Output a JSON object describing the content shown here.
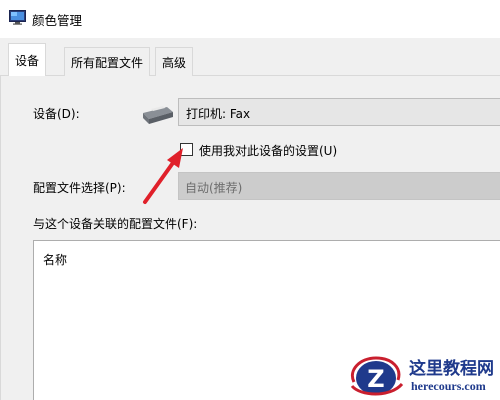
{
  "window": {
    "title": "颜色管理"
  },
  "tabs": [
    {
      "label": "设备",
      "active": true
    },
    {
      "label": "所有配置文件",
      "active": false
    },
    {
      "label": "高级",
      "active": false
    }
  ],
  "device": {
    "label": "设备(D):",
    "value": "打印机: Fax",
    "icon": "printer-icon"
  },
  "use_my_settings": {
    "label": "使用我对此设备的设置(U)",
    "checked": false
  },
  "profile_selection": {
    "label": "配置文件选择(P):",
    "value": "自动(推荐)",
    "disabled": true
  },
  "associated_profiles": {
    "label": "与这个设备关联的配置文件(F):",
    "column_header": "名称",
    "rows": []
  },
  "watermark": {
    "title": "这里教程网",
    "url": "herecours.com"
  },
  "colors": {
    "accent_arrow": "#e0202a",
    "watermark_blue": "#1f3a8c"
  }
}
